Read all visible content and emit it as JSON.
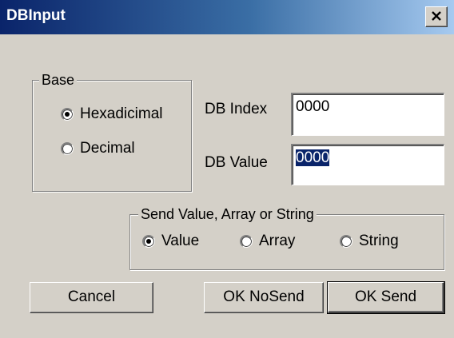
{
  "window": {
    "title": "DBInput"
  },
  "base_group": {
    "legend": "Base",
    "options": [
      {
        "label": "Hexadicimal",
        "selected": true
      },
      {
        "label": "Decimal",
        "selected": false
      }
    ]
  },
  "fields": {
    "db_index": {
      "label": "DB Index",
      "value": "0000"
    },
    "db_value": {
      "label": "DB Value",
      "value": "0000"
    }
  },
  "send_group": {
    "legend": "Send Value, Array or String",
    "options": [
      {
        "label": "Value",
        "selected": true
      },
      {
        "label": "Array",
        "selected": false
      },
      {
        "label": "String",
        "selected": false
      }
    ]
  },
  "buttons": {
    "cancel": "Cancel",
    "ok_nosend": "OK NoSend",
    "ok_send": "OK Send"
  },
  "icons": {
    "close": "close-icon",
    "radio_dot": "radio-selected-dot"
  }
}
